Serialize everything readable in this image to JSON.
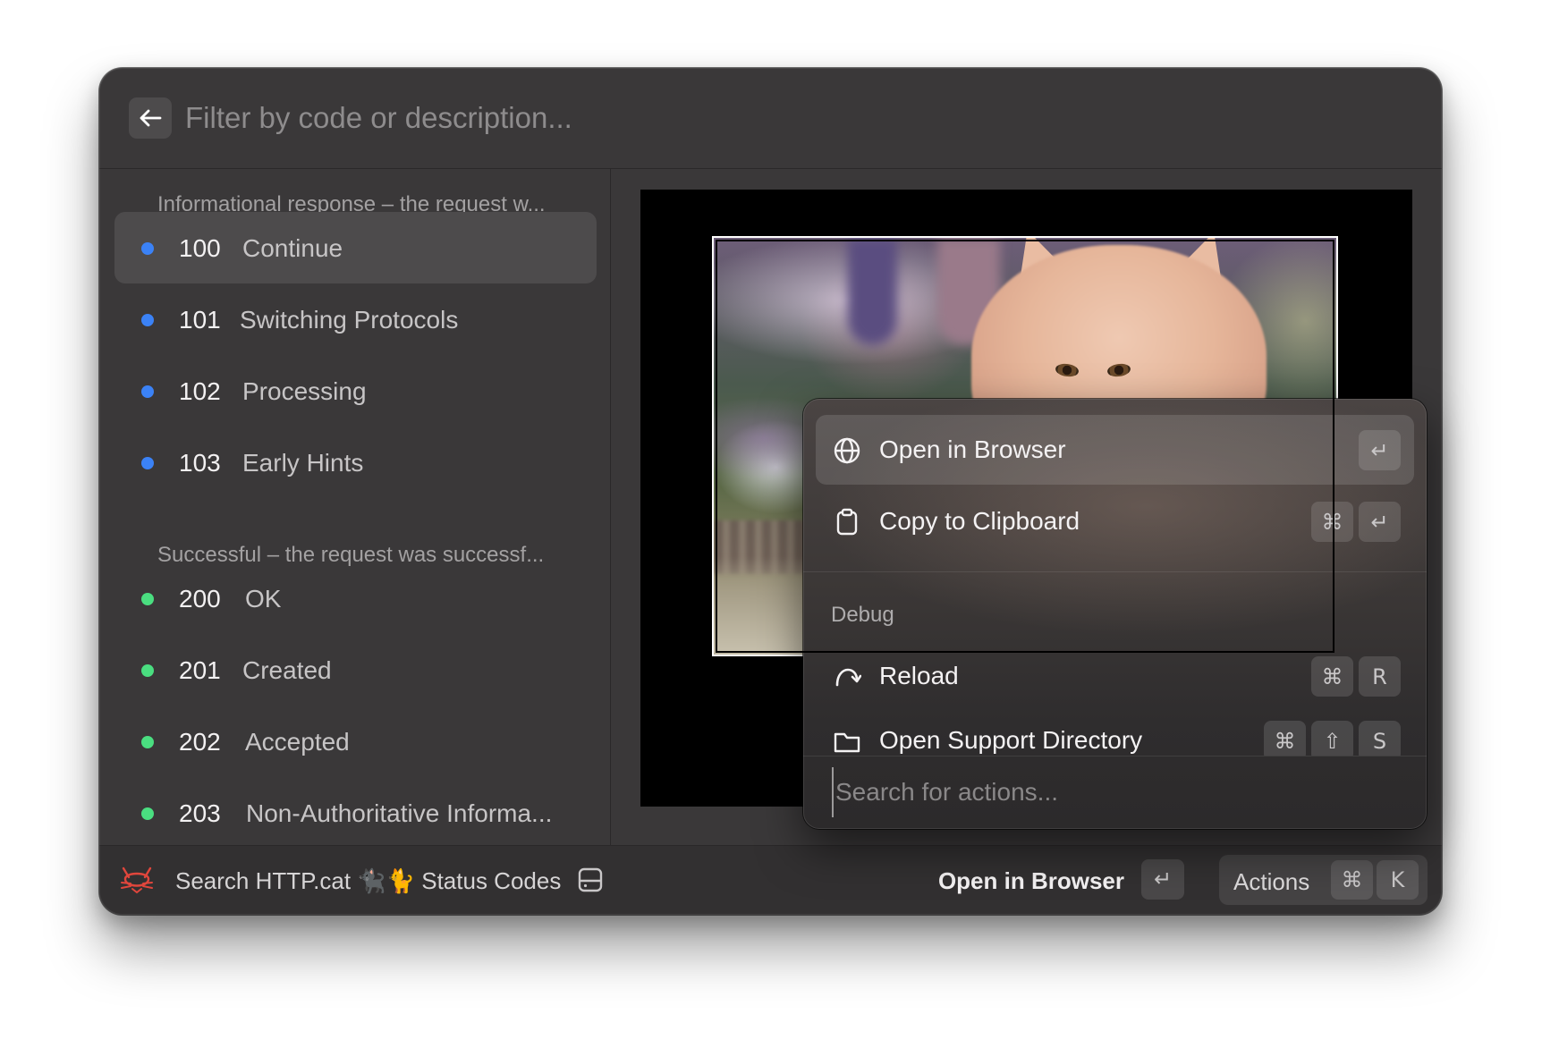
{
  "search": {
    "placeholder": "Filter by code or description..."
  },
  "sections": [
    {
      "title": "Informational response – the request w...",
      "color": "#3b82f6",
      "items": [
        {
          "code": "100",
          "description": "Continue",
          "selected": true
        },
        {
          "code": "101",
          "description": "Switching Protocols"
        },
        {
          "code": "102",
          "description": "Processing"
        },
        {
          "code": "103",
          "description": "Early Hints"
        }
      ]
    },
    {
      "title": "Successful – the request was successf...",
      "color": "#4ade80",
      "items": [
        {
          "code": "200",
          "description": "OK"
        },
        {
          "code": "201",
          "description": "Created"
        },
        {
          "code": "202",
          "description": "Accepted"
        },
        {
          "code": "203",
          "description": "Non-Authoritative Informa..."
        }
      ]
    }
  ],
  "actions": {
    "items": [
      {
        "label": "Open in Browser",
        "icon": "globe-icon",
        "keys": [
          "↵"
        ]
      },
      {
        "label": "Copy to Clipboard",
        "icon": "clipboard-icon",
        "keys": [
          "⌘",
          "↵"
        ]
      }
    ],
    "debug_section": "Debug",
    "debug_items": [
      {
        "label": "Reload",
        "icon": "reload-icon",
        "keys": [
          "⌘",
          "R"
        ]
      },
      {
        "label": "Open Support Directory",
        "icon": "folder-icon",
        "keys": [
          "⌘",
          "⇧",
          "S"
        ]
      }
    ],
    "search_placeholder": "Search for actions..."
  },
  "footer": {
    "brand_label": "Search HTTP.cat 🐈‍⬛🐈 Status Codes",
    "primary_action": "Open in Browser",
    "primary_key": "↵",
    "actions_label": "Actions",
    "actions_keys": [
      "⌘",
      "K"
    ]
  }
}
